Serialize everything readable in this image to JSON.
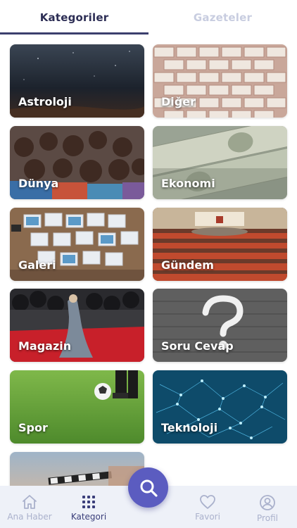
{
  "tabs": [
    {
      "label": "Kategoriler",
      "active": true
    },
    {
      "label": "Gazeteler",
      "active": false
    }
  ],
  "categories": [
    {
      "label": "Astroloji"
    },
    {
      "label": "Diğer"
    },
    {
      "label": "Dünya"
    },
    {
      "label": "Ekonomi"
    },
    {
      "label": "Galeri"
    },
    {
      "label": "Gündem"
    },
    {
      "label": "Magazin"
    },
    {
      "label": "Soru Cevap"
    },
    {
      "label": "Spor"
    },
    {
      "label": "Teknoloji"
    },
    {
      "label": ""
    }
  ],
  "bottom_nav": {
    "items": [
      {
        "label": "Ana Haber",
        "icon": "home-icon"
      },
      {
        "label": "Kategori",
        "icon": "grid-icon"
      },
      {
        "label": "Favori",
        "icon": "heart-icon"
      },
      {
        "label": "Profil",
        "icon": "user-icon"
      }
    ],
    "fab_icon": "search-icon"
  },
  "colors": {
    "accent": "#5b5cc0",
    "tab_active": "#2d2e55",
    "tab_inactive": "#c8cde0",
    "nav_bg": "#eef1f8"
  }
}
